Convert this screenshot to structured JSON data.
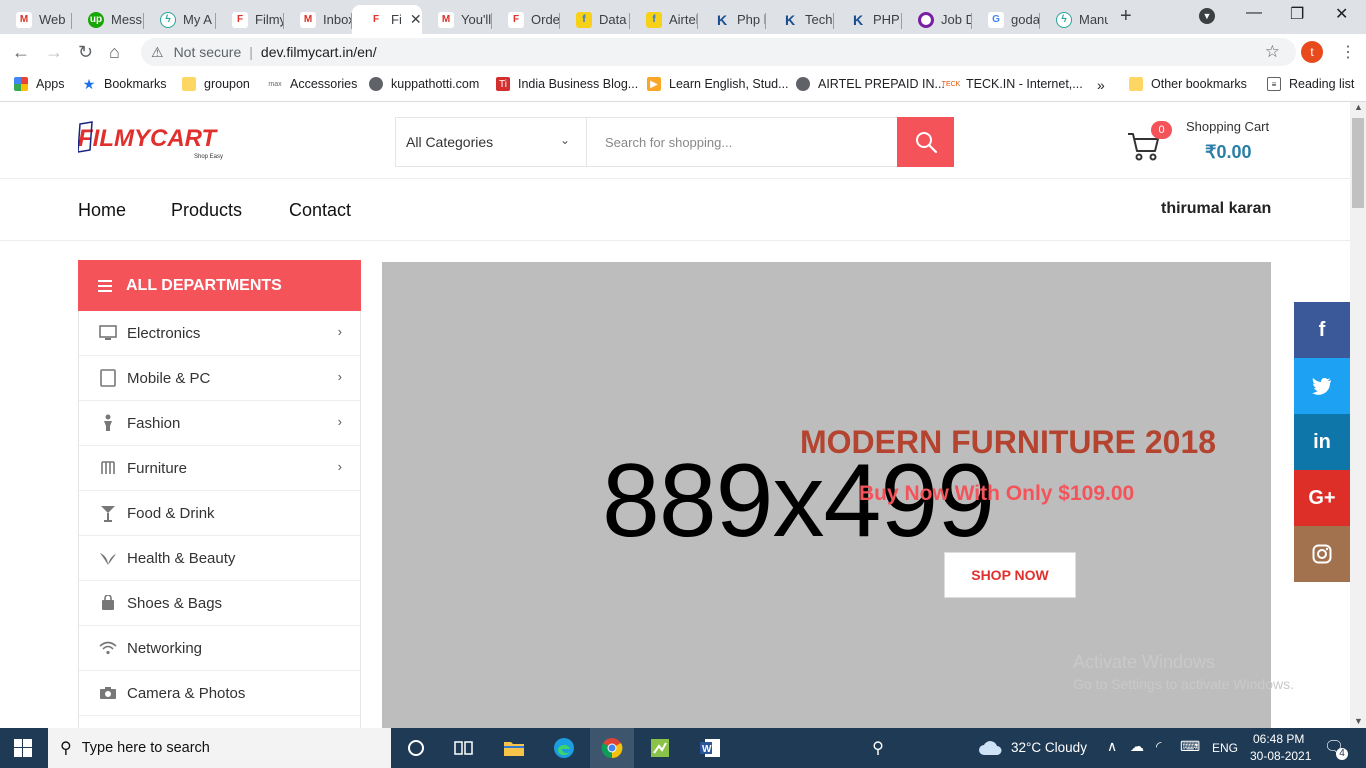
{
  "browser": {
    "tabs": [
      {
        "label": "Web",
        "icon": "gmail-icon"
      },
      {
        "label": "Mess",
        "icon": "upwork-icon"
      },
      {
        "label": "My A",
        "icon": "site-icon"
      },
      {
        "label": "Filmy",
        "icon": "filmycart-icon"
      },
      {
        "label": "Inbox",
        "icon": "gmail-icon"
      },
      {
        "label": "Fi",
        "icon": "filmycart-icon",
        "active": true
      },
      {
        "label": "You'll",
        "icon": "gmail-icon"
      },
      {
        "label": "Order",
        "icon": "filmycart-icon"
      },
      {
        "label": "Data",
        "icon": "flipkart-icon"
      },
      {
        "label": "Airtel",
        "icon": "flipkart-icon"
      },
      {
        "label": "Php l",
        "icon": "k-icon"
      },
      {
        "label": "Techr",
        "icon": "k-icon"
      },
      {
        "label": "PHP",
        "icon": "k-icon"
      },
      {
        "label": "Job D",
        "icon": "ring-icon"
      },
      {
        "label": "goda",
        "icon": "google-icon"
      },
      {
        "label": "Manu",
        "icon": "site-icon"
      }
    ],
    "address": {
      "security": "Not secure",
      "url": "dev.filmycart.in/en/"
    },
    "profile_initial": "t",
    "bookmarks": [
      {
        "label": "Apps"
      },
      {
        "label": "Bookmarks"
      },
      {
        "label": "groupon"
      },
      {
        "label": "Accessories"
      },
      {
        "label": "kuppathotti.com"
      },
      {
        "label": "India Business Blog..."
      },
      {
        "label": "Learn English, Stud..."
      },
      {
        "label": "AIRTEL PREPAID IN..."
      },
      {
        "label": "TECK.IN - Internet,..."
      },
      {
        "label": "»"
      },
      {
        "label": "Other bookmarks"
      },
      {
        "label": "Reading list"
      }
    ]
  },
  "header": {
    "logo_text": "FILMYCART",
    "logo_tagline": "Shop Easy",
    "category_select": "All Categories",
    "search_placeholder": "Search for shopping...",
    "cart_count": "0",
    "cart_title": "Shopping Cart",
    "cart_total": "₹0.00"
  },
  "nav": {
    "links": [
      "Home",
      "Products",
      "Contact"
    ],
    "user": "thirumal karan"
  },
  "departments": {
    "title": "ALL DEPARTMENTS",
    "items": [
      {
        "label": "Electronics",
        "icon": "monitor-icon",
        "has_sub": true
      },
      {
        "label": "Mobile & PC",
        "icon": "tablet-icon",
        "has_sub": true
      },
      {
        "label": "Fashion",
        "icon": "person-icon",
        "has_sub": true
      },
      {
        "label": "Furniture",
        "icon": "furniture-icon",
        "has_sub": true
      },
      {
        "label": "Food & Drink",
        "icon": "cocktail-icon",
        "has_sub": false
      },
      {
        "label": "Health & Beauty",
        "icon": "leaf-icon",
        "has_sub": false
      },
      {
        "label": "Shoes & Bags",
        "icon": "bag-icon",
        "has_sub": false
      },
      {
        "label": "Networking",
        "icon": "wifi-icon",
        "has_sub": false
      },
      {
        "label": "Camera & Photos",
        "icon": "camera-icon",
        "has_sub": false
      }
    ]
  },
  "banner": {
    "placeholder": "889x499",
    "title": "MODERN FURNITURE 2018",
    "subtitle": "Buy Now With Only $109.00",
    "button": "SHOP NOW"
  },
  "social": [
    {
      "label": "f",
      "name": "facebook-icon",
      "color": "#3b5998"
    },
    {
      "label": "🐦",
      "name": "twitter-icon",
      "color": "#1da1f2"
    },
    {
      "label": "in",
      "name": "linkedin-icon",
      "color": "#0e76a8"
    },
    {
      "label": "G+",
      "name": "google-plus-icon",
      "color": "#dd2f27"
    },
    {
      "label": "◎",
      "name": "instagram-icon",
      "color": "#a2724f"
    }
  ],
  "watermark": {
    "line1": "Activate Windows",
    "line2": "Go to Settings to activate Windows."
  },
  "taskbar": {
    "search": "Type here to search",
    "weather": "32°C  Cloudy",
    "language": "ENG",
    "time": "06:48 PM",
    "date": "30-08-2021",
    "notifications": "4"
  },
  "colors": {
    "accent": "#f4535a",
    "cart_total": "#2b7ea7",
    "banner_bg": "#bdbdbd",
    "banner_title": "#b4442f"
  }
}
